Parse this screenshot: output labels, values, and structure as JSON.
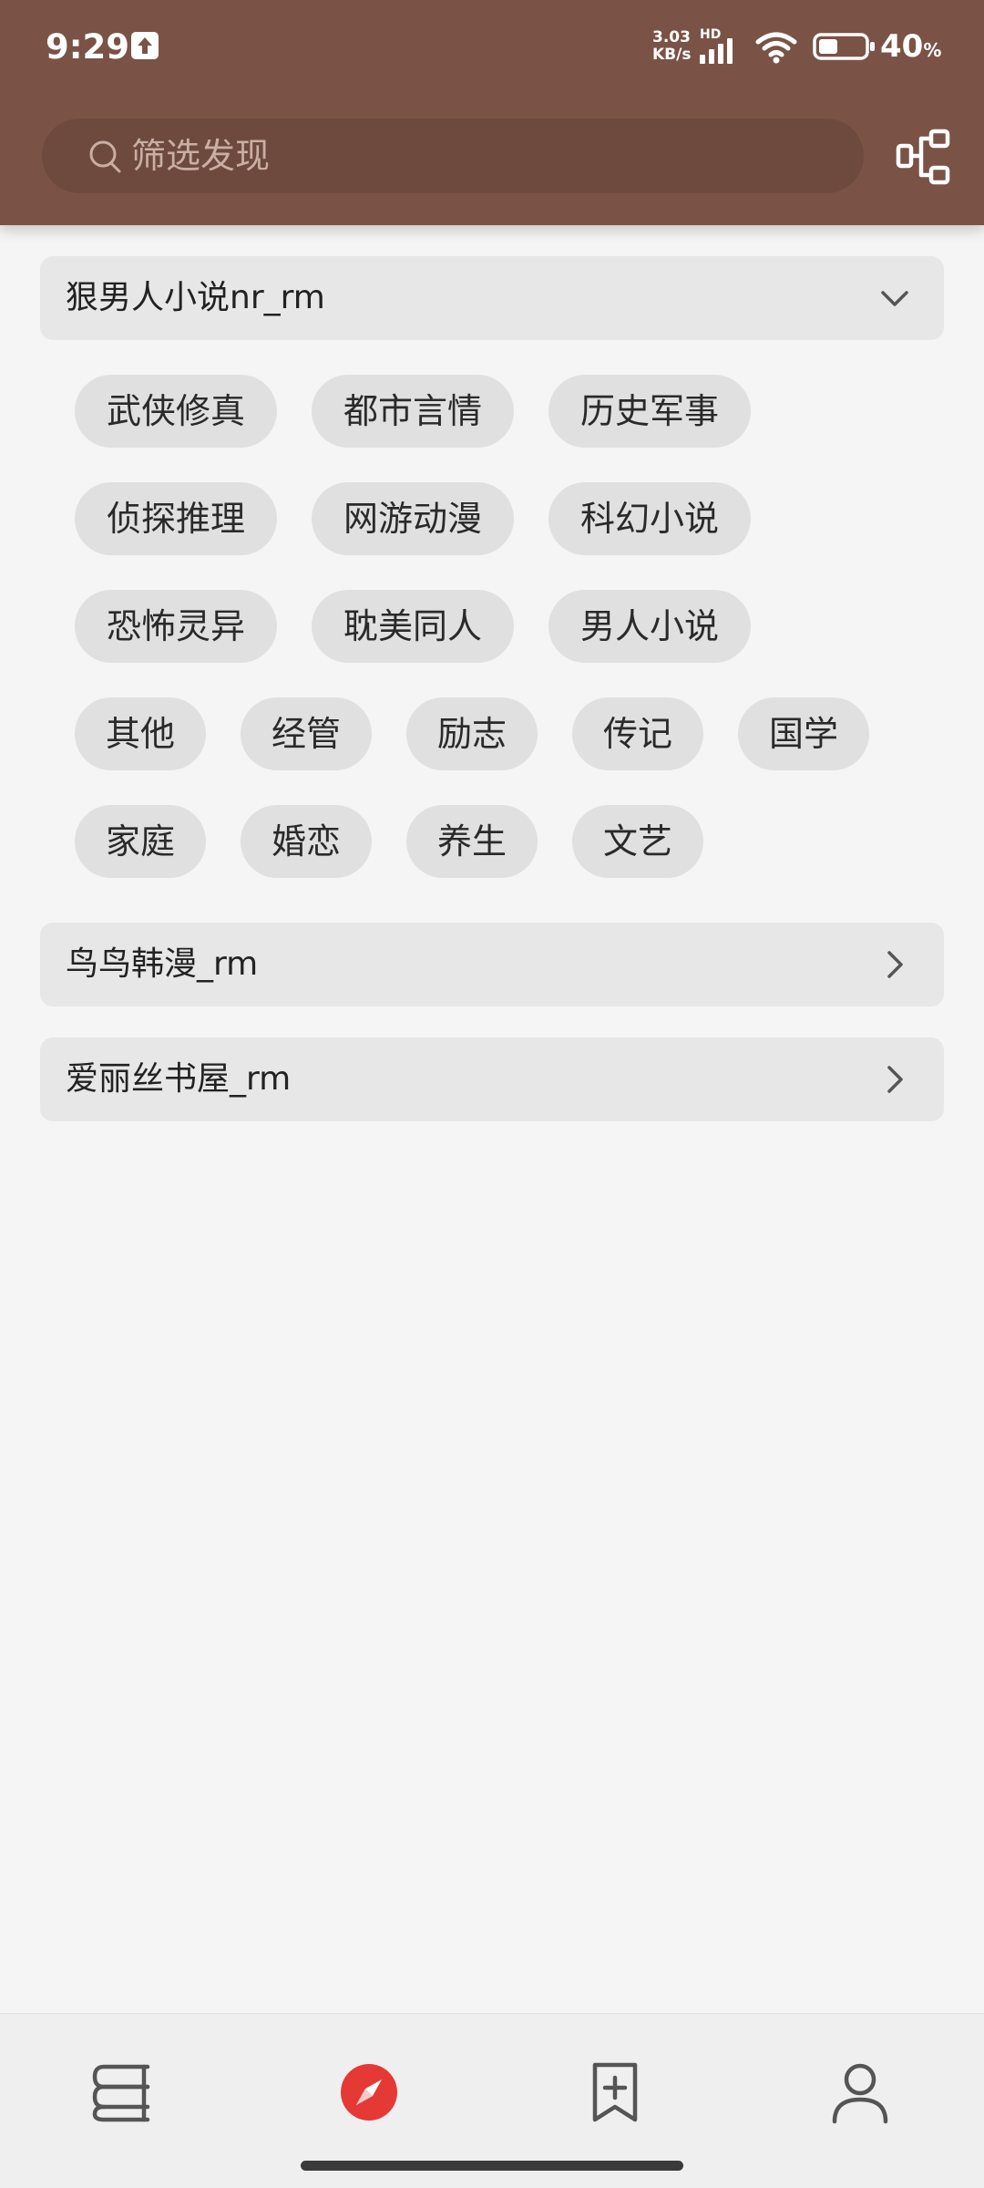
{
  "status_bar": {
    "time": "9:29",
    "net_speed_value": "3.03",
    "net_speed_unit": "KB/s",
    "network_label": "HD",
    "battery_percent": "40",
    "battery_unit": "%"
  },
  "search": {
    "placeholder": "筛选发现",
    "value": ""
  },
  "groups": [
    {
      "title": "狠男人小说nr_rm",
      "expanded": true,
      "tags": [
        "武侠修真",
        "都市言情",
        "历史军事",
        "侦探推理",
        "网游动漫",
        "科幻小说",
        "恐怖灵异",
        "耽美同人",
        "男人小说",
        "其他",
        "经管",
        "励志",
        "传记",
        "国学",
        "家庭",
        "婚恋",
        "养生",
        "文艺"
      ]
    },
    {
      "title": "鸟鸟韩漫_rm",
      "expanded": false
    },
    {
      "title": "爱丽丝书屋_rm",
      "expanded": false
    }
  ],
  "bottom_nav": {
    "items": [
      {
        "icon": "bookshelf-icon",
        "active": false
      },
      {
        "icon": "compass-icon",
        "active": true
      },
      {
        "icon": "bookmark-add-icon",
        "active": false
      },
      {
        "icon": "person-icon",
        "active": false
      }
    ],
    "accent_color": "#e53935"
  },
  "colors": {
    "header": "#7a5346",
    "background": "#f5f5f5",
    "tag_bg": "#e0e0e0"
  }
}
